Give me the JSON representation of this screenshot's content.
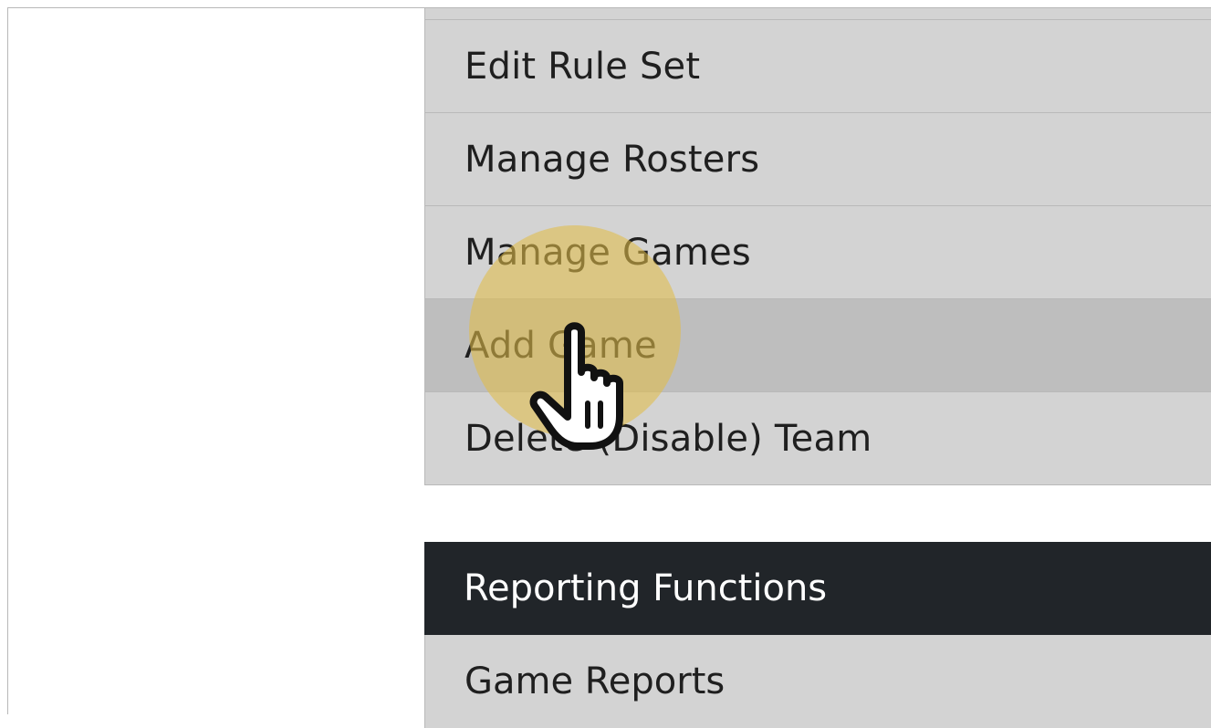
{
  "menu": {
    "items": [
      {
        "label": "Edit Rule Set",
        "state": "default"
      },
      {
        "label": "Manage Rosters",
        "state": "default"
      },
      {
        "label": "Manage Games",
        "state": "default"
      },
      {
        "label": "Add Game",
        "state": "hover"
      },
      {
        "label": "Delete (Disable) Team",
        "state": "default"
      }
    ]
  },
  "reporting": {
    "header": "Reporting Functions",
    "items": [
      {
        "label": "Game Reports"
      }
    ]
  },
  "overlay": {
    "cursor_icon": "hand-pointer-icon",
    "highlight_color": "#e0bc48"
  },
  "colors": {
    "menu_bg": "#d3d3d3",
    "menu_hover_bg": "#bebebe",
    "section_header_bg": "#212529"
  }
}
